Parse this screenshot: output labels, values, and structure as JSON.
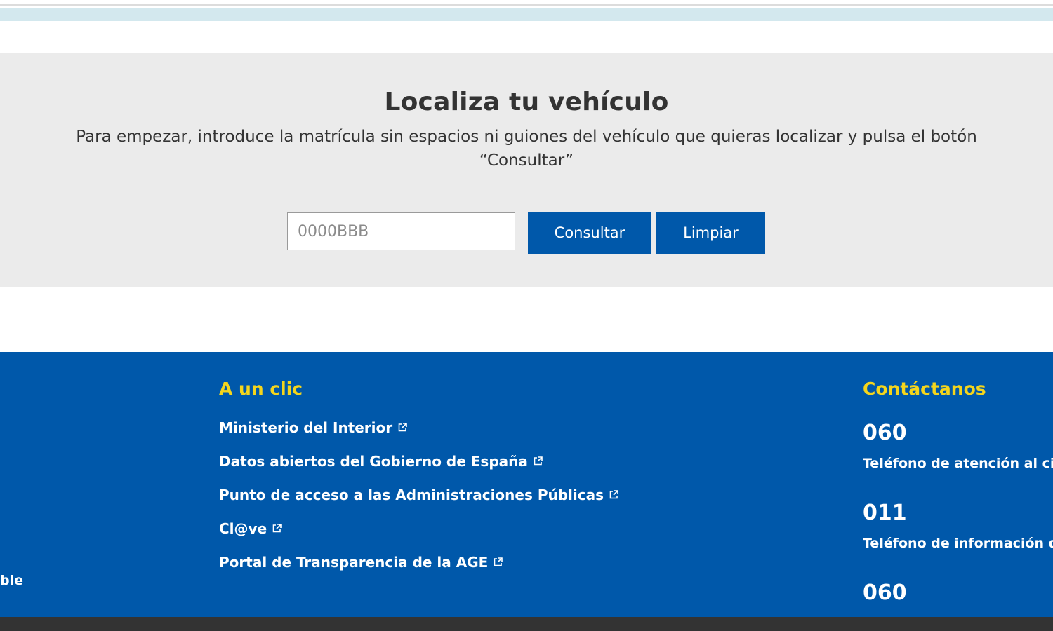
{
  "search": {
    "title": "Localiza tu vehículo",
    "intro": "Para empezar, introduce la matrícula sin espacios ni guiones del vehículo que quieras localizar y pulsa el botón “Consultar”",
    "placeholder": "0000BBB",
    "consult_label": "Consultar",
    "clear_label": "Limpiar"
  },
  "footer": {
    "left_fragment": "ble",
    "quick_links": {
      "title": "A un clic",
      "items": [
        {
          "label": "Ministerio del Interior",
          "icon": "external-link-icon"
        },
        {
          "label": "Datos abiertos del Gobierno de España",
          "icon": "external-link-icon"
        },
        {
          "label": "Punto de acceso a las Administraciones Públicas",
          "icon": "external-link-icon"
        },
        {
          "label": "Cl@ve",
          "icon": "external-link-icon"
        },
        {
          "label": "Portal de Transparencia de la AGE",
          "icon": "external-link-icon"
        }
      ]
    },
    "contact": {
      "title": "Contáctanos",
      "items": [
        {
          "number": "060",
          "description": "Teléfono de atención al ciud"
        },
        {
          "number": "011",
          "description": "Teléfono de información de"
        },
        {
          "number": "060",
          "description": ""
        }
      ]
    }
  },
  "colors": {
    "primary_blue": "#0058aa",
    "accent_yellow": "#f4d51c",
    "section_gray": "#ebebeb",
    "top_strip": "#d3e8ee",
    "bottom_bar": "#333333"
  }
}
